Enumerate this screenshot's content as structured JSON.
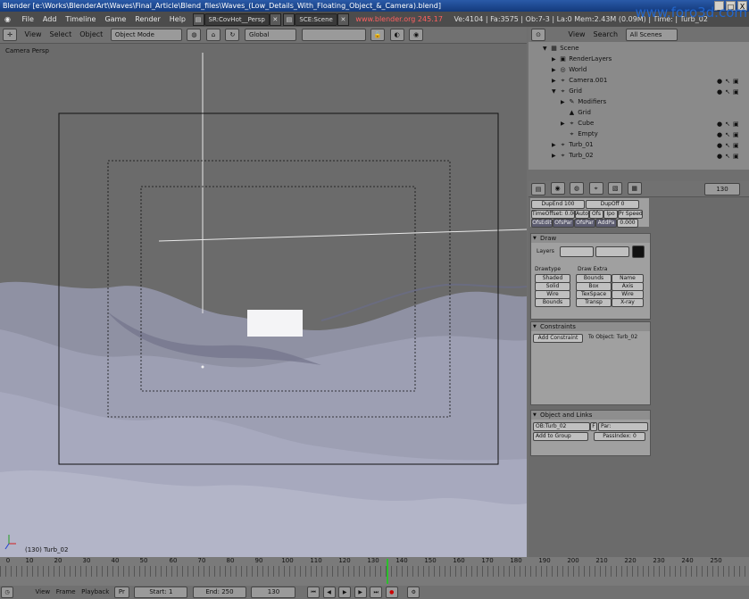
{
  "window": {
    "title": "Blender [e:\\Works\\BlenderArt\\Waves\\Final_Article\\Blend_files\\Waves_(Low_Details_With_Floating_Object_&_Camera).blend]",
    "controls": [
      "_",
      "□",
      "X"
    ]
  },
  "menubar": {
    "items": [
      "File",
      "Add",
      "Timeline",
      "Game",
      "Render",
      "Help"
    ],
    "screen": "SR:CovHot__Persp",
    "scene": "SCE:Scene",
    "url": "www.blender.org 245.17",
    "stats": "Ve:4104 | Fa:3575 | Ob:7-3 | La:0   Mem:2.43M (0.09M)  | Time:  | Turb_02",
    "watermark": "www.foro3d.com"
  },
  "viewport_header": {
    "menus": [
      "View",
      "Select",
      "Object"
    ],
    "mode": "Object Mode",
    "orientation": "Global"
  },
  "viewport": {
    "label": "Camera Persp",
    "object_status": "(130) Turb_02"
  },
  "outliner": {
    "menus": [
      "View",
      "Search"
    ],
    "filter": "All Scenes",
    "items": [
      "Scene",
      "RenderLayers",
      "World",
      "Camera.001",
      "Grid",
      "Modifiers",
      "Grid",
      "Cube",
      "Empty",
      "Turb_01",
      "Turb_02"
    ]
  },
  "buttons": {
    "frame": "130",
    "anim": {
      "dupend": "DupEnd 100",
      "dupoff": "DupOff 0",
      "timeoffset": "TimeOffset: 0.00",
      "toggles": [
        "Auto",
        "Ofs",
        "Ipo",
        "Pr Speed"
      ],
      "extras": [
        "OfsEdit",
        "OfsPar",
        "OfsPar",
        "AddPa",
        "0.000"
      ]
    },
    "draw": {
      "title": "Draw",
      "layers_label": "Layers",
      "drawtype_label": "Drawtype",
      "drawextra_label": "Draw Extra",
      "drawtypes": [
        "Shaded",
        "Solid",
        "Wire",
        "Bounds"
      ],
      "extra_col1": [
        "Bounds",
        "Box",
        "TexSpace",
        "Transp"
      ],
      "extra_col2": [
        "Name",
        "Axis",
        "Wire",
        "X-ray"
      ]
    },
    "constraints": {
      "title": "Constraints",
      "add_button": "Add Constraint",
      "to_object": "To Object: Turb_02"
    },
    "object_links": {
      "title": "Object and Links",
      "ob_name": "OB:Turb_02",
      "f_button": "F",
      "par": "Par:",
      "add_group": "Add to Group",
      "pass_index": "PassIndex: 0"
    }
  },
  "timeline": {
    "ticks": [
      "0",
      "10",
      "20",
      "30",
      "40",
      "50",
      "60",
      "70",
      "80",
      "90",
      "100",
      "110",
      "120",
      "130",
      "140",
      "150",
      "160",
      "170",
      "180",
      "190",
      "200",
      "210",
      "220",
      "230",
      "240",
      "250"
    ],
    "current_frame": 130
  },
  "bottombar": {
    "menus": [
      "View",
      "Frame",
      "Playback"
    ],
    "pr": "Pr",
    "start": "Start: 1",
    "end": "End: 250",
    "frame": "130"
  },
  "colors": {
    "title_bg": "#1e4a94",
    "viewport_bg": "#6b6b6b",
    "terrain": "#a7a9be",
    "current_frame": "#2cbf2c",
    "url": "#ff6060"
  }
}
